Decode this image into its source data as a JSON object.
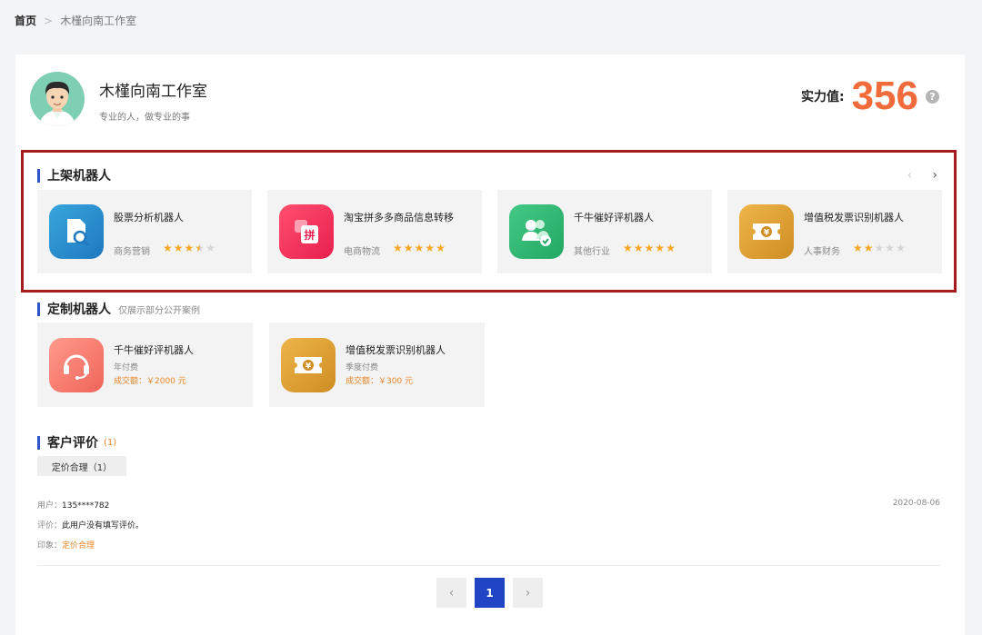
{
  "breadcrumb": {
    "home": "首页",
    "separator": ">",
    "current": "木槿向南工作室"
  },
  "profile": {
    "name": "木槿向南工作室",
    "slogan": "专业的人，做专业的事",
    "strength_label": "实力值:",
    "strength_value": "356",
    "help_glyph": "?"
  },
  "listed": {
    "title": "上架机器人",
    "prev_arrow": "‹",
    "next_arrow": "›",
    "items": [
      {
        "name": "股票分析机器人",
        "category": "商务营销",
        "rating": 3.5,
        "icon": "stock-analysis-icon",
        "color": "#2f8fd0"
      },
      {
        "name": "淘宝拼多多商品信息转移",
        "category": "电商物流",
        "rating": 5,
        "icon": "pinduoduo-icon",
        "color": "#f0355f"
      },
      {
        "name": "千牛催好评机器人",
        "category": "其他行业",
        "rating": 5,
        "icon": "users-check-icon",
        "color": "#33b873"
      },
      {
        "name": "增值税发票识别机器人",
        "category": "人事财务",
        "rating": 2,
        "icon": "invoice-ticket-icon",
        "color": "#e2a437"
      }
    ]
  },
  "custom": {
    "title": "定制机器人",
    "subtitle": "仅展示部分公开案例",
    "items": [
      {
        "name": "千牛催好评机器人",
        "plan": "年付费",
        "deal": "成交额：￥2000 元",
        "icon": "headset-icon",
        "color": "#f47c72"
      },
      {
        "name": "增值税发票识别机器人",
        "plan": "季度付费",
        "deal": "成交额：￥300 元",
        "icon": "invoice-ticket-icon",
        "color": "#e2a437"
      }
    ]
  },
  "reviews": {
    "title": "客户评价",
    "count": "(1)",
    "tag": "定价合理（1）",
    "user_label": "用户：",
    "user_value": "135****782",
    "comment_label": "评价：",
    "comment_value": "此用户没有填写评价。",
    "impression_label": "印象：",
    "impression_value": "定价合理",
    "date": "2020-08-06"
  },
  "pagination": {
    "prev": "‹",
    "current": "1",
    "next": "›"
  }
}
